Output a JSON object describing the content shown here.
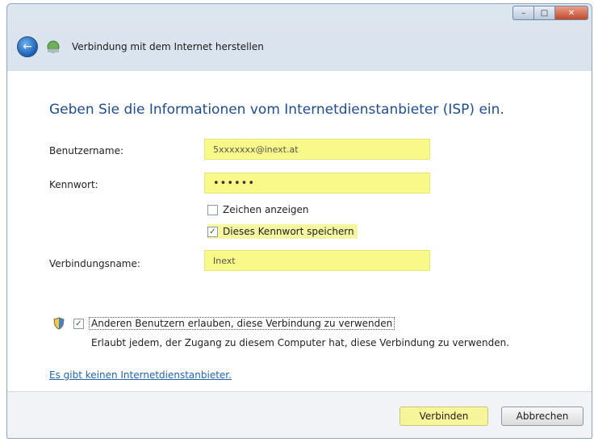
{
  "window": {
    "caption_buttons": {
      "minimize": "–",
      "maximize": "□",
      "close": "✕"
    }
  },
  "nav": {
    "title": "Verbindung mit dem Internet herstellen",
    "back_icon": "back-arrow-icon",
    "network_icon": "network-icon"
  },
  "heading": "Geben Sie die Informationen vom Internetdienstanbieter (ISP) ein.",
  "fields": {
    "username": {
      "label": "Benutzername:",
      "value": "5xxxxxxx@inext.at"
    },
    "password": {
      "label": "Kennwort:",
      "value": "••••••"
    },
    "connection_name": {
      "label": "Verbindungsname:",
      "value": "Inext"
    }
  },
  "checks": {
    "show_chars": {
      "label": "Zeichen anzeigen",
      "checked": false
    },
    "save_password": {
      "label": "Dieses Kennwort speichern",
      "checked": true
    },
    "allow_others": {
      "label": "Anderen Benutzern erlauben, diese Verbindung zu verwenden",
      "checked": true
    }
  },
  "allow_description": "Erlaubt jedem, der Zugang zu diesem Computer hat, diese Verbindung zu verwenden.",
  "no_isp_link": "Es gibt keinen Internetdienstanbieter.",
  "buttons": {
    "connect": "Verbinden",
    "cancel": "Abbrechen"
  },
  "colors": {
    "highlight": "#f9f98a",
    "heading": "#1f4d8f",
    "link": "#2164b0"
  }
}
